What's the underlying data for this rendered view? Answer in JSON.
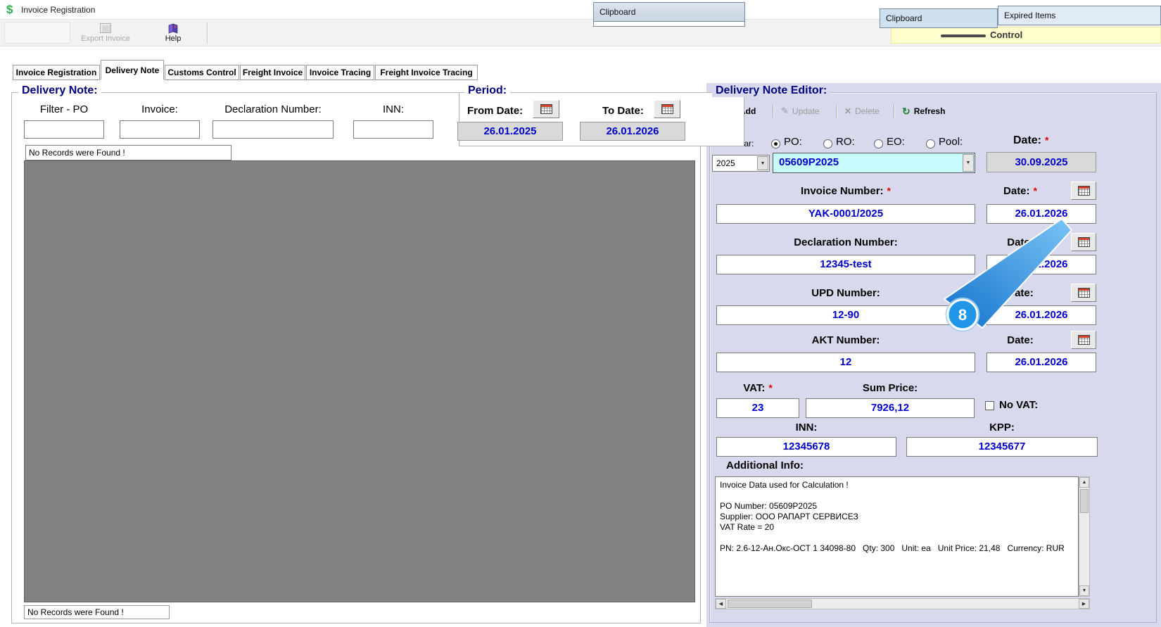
{
  "ui": {
    "required_marker": "*",
    "arrow_up": "▲",
    "arrow_down": "▼",
    "arrow_left": "◀",
    "arrow_right": "▶",
    "dropdown_arrow": "▼"
  },
  "icons": {
    "dollar_glyph": "$",
    "refresh_glyph": "↻",
    "update_glyph": "✎",
    "delete_glyph": "✕"
  },
  "window": {
    "title": "Invoice Registration"
  },
  "toolbar": {
    "export_label": "Export Invoice",
    "help_label": "Help"
  },
  "overlays": {
    "clipboard_center": "Clipboard",
    "clipboard_right": "Clipboard",
    "expired_items": "Expired Items",
    "control_text": "Control"
  },
  "tabs": [
    {
      "label": "Invoice Registration"
    },
    {
      "label": "Delivery Note"
    },
    {
      "label": "Customs Control"
    },
    {
      "label": "Freight Invoice"
    },
    {
      "label": "Invoice Tracing"
    },
    {
      "label": "Freight Invoice Tracing"
    }
  ],
  "delivery_note": {
    "title": "Delivery Note:",
    "filter_po_label": "Filter - PO",
    "invoice_label": "Invoice:",
    "declaration_label": "Declaration Number:",
    "inn_label": "INN:",
    "no_records_top": "No Records were Found !",
    "no_records_bottom": "No Records were Found !"
  },
  "period": {
    "title": "Period:",
    "from_label": "From Date:",
    "from_value": "26.01.2025",
    "to_label": "To Date:",
    "to_value": "26.01.2026"
  },
  "editor": {
    "title": "Delivery Note Editor:",
    "toolbar": {
      "add": "Add",
      "update": "Update",
      "delete": "Delete",
      "refresh": "Refresh"
    },
    "filter_year_label": "Filter Year:",
    "year_value": "2025",
    "radio_po": "PO:",
    "radio_ro": "RO:",
    "radio_eo": "EO:",
    "radio_pool": "Pool:",
    "po_value": "05609P2025",
    "header_date_label": "Date:",
    "po_date_value": "30.09.2025",
    "fields": [
      {
        "label": "Invoice Number:",
        "value": "YAK-0001/2025",
        "date_label": "Date:",
        "date_value": "26.01.2026"
      },
      {
        "label": "Declaration Number:",
        "value": "12345-test",
        "date_label": "Date:",
        "date_value": "26.01.2026"
      },
      {
        "label": "UPD Number:",
        "value": "12-90",
        "date_label": "Date:",
        "date_value": "26.01.2026"
      },
      {
        "label": "AKT Number:",
        "value": "12",
        "date_label": "Date:",
        "date_value": "26.01.2026"
      }
    ],
    "vat_label": "VAT:",
    "vat_value": "23",
    "sum_price_label": "Sum Price:",
    "sum_price_value": "7926,12",
    "no_vat_label": "No VAT:",
    "inn_label": "INN:",
    "inn_value": "12345678",
    "kpp_label": "KPP:",
    "kpp_value": "12345677",
    "additional_info_label": "Additional Info:",
    "additional_info_text": "Invoice Data used for Calculation !\n\nPO Number: 05609P2025\nSupplier: ООО РАПАРТ СЕРВИСЕЗ\nVAT Rate = 20\n\nPN: 2.6-12-Ан.Окс-ОСТ 1 34098-80   Qty: 300   Unit: ea   Unit Price: 21,48   Currency: RUR"
  },
  "callout": {
    "number": "8"
  }
}
